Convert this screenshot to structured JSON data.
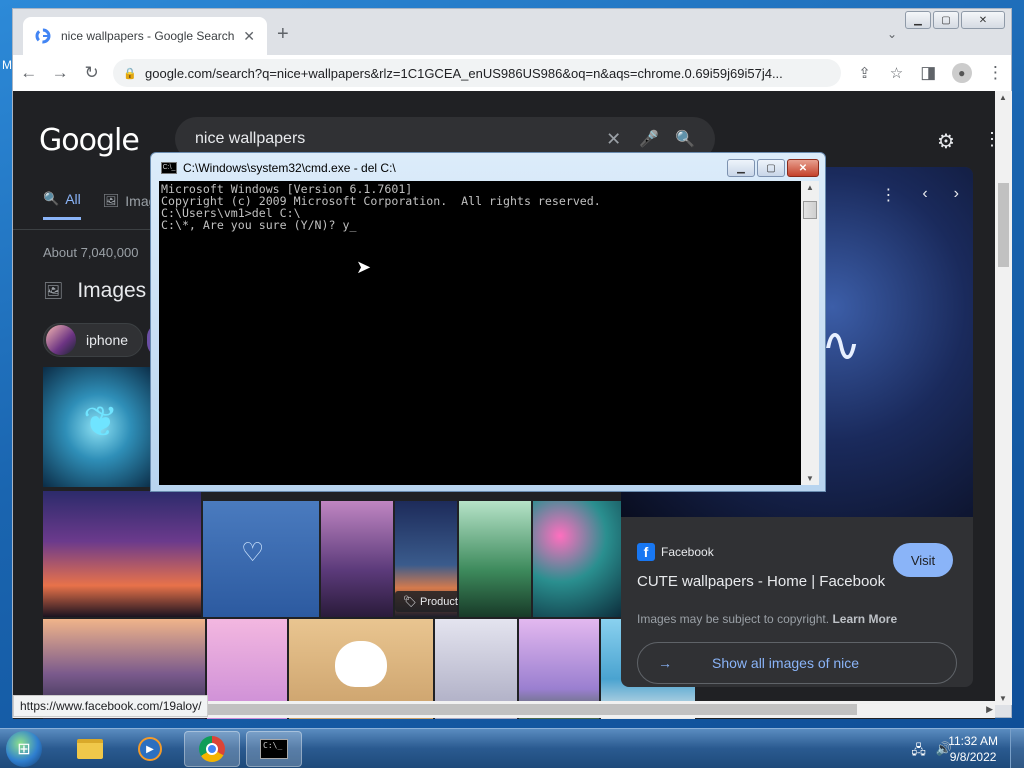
{
  "desktop": {
    "edge_letter": "M"
  },
  "browser": {
    "tab": {
      "title": "nice wallpapers - Google Search",
      "close": "✕"
    },
    "new_tab": "+",
    "tab_dropdown": "⌄",
    "window_buttons": {
      "minimize": "▁",
      "maximize": "▢",
      "close": "✕"
    },
    "toolbar": {
      "back": "←",
      "forward": "→",
      "reload": "↻",
      "url": "google.com/search?q=nice+wallpapers&rlz=1C1GCEA_enUS986US986&oq=n&aqs=chrome.0.69i59j69i57j4...",
      "share": "⇪",
      "bookmark": "☆",
      "side_panel": "◨",
      "profile": "●",
      "menu": "⋮"
    },
    "status_url": "https://www.facebook.com/19aloy/"
  },
  "google": {
    "logo": "Google",
    "search": {
      "query": "nice wallpapers",
      "clear": "✕",
      "mic": "🎤",
      "lens": "🔍"
    },
    "settings": "⚙",
    "apps": "⋮",
    "tabs": [
      {
        "label": "All",
        "icon": "🔍",
        "active": true
      },
      {
        "label": "Imag",
        "icon": "🖼"
      }
    ],
    "result_stats": "About 7,040,000",
    "images_heading": "Images",
    "chip": {
      "label": "iphone"
    },
    "product_badge": "🏷 Product",
    "panel": {
      "controls": {
        "more": "⋮",
        "prev": "‹",
        "next": "›"
      },
      "source": "Facebook",
      "title": "CUTE wallpapers - Home | Facebook",
      "visit": "Visit",
      "copyright": "Images may be subject to copyright.",
      "learn_more": "Learn More",
      "show_all": "Show all images of nice",
      "show_all_arrow": "→"
    }
  },
  "cmd": {
    "title": "C:\\Windows\\system32\\cmd.exe - del  C:\\",
    "icon_text": "C:\\_",
    "buttons": {
      "minimize": "▁",
      "maximize": "▢",
      "close": "✕"
    },
    "lines": [
      "Microsoft Windows [Version 6.1.7601]",
      "Copyright (c) 2009 Microsoft Corporation.  All rights reserved.",
      "",
      "C:\\Users\\vm1>del C:\\",
      "C:\\*, Are you sure (Y/N)? y_"
    ]
  },
  "taskbar": {
    "start": "⊞",
    "tray": {
      "network": "🖧",
      "volume": "🔊"
    },
    "time": "11:32 AM",
    "date": "9/8/2022"
  }
}
